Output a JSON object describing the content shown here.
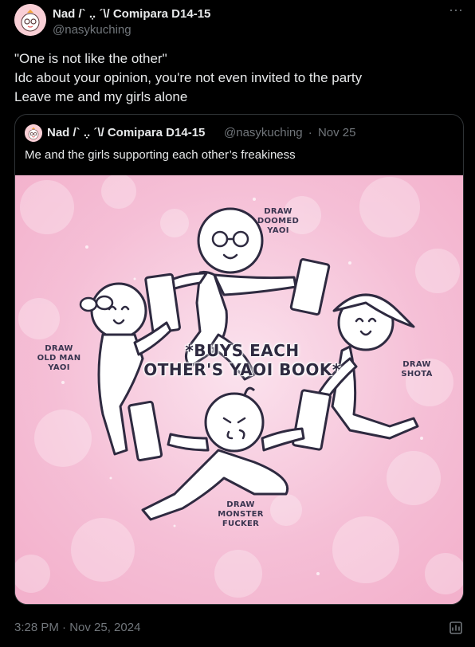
{
  "author": {
    "display_name": "Nad /` .̣. ´\\/ Comipara D14-15",
    "handle": "@nasykuching"
  },
  "tweet": {
    "lines": [
      "\"One is not like the other\"",
      "Idc about your opinion, you're not even invited to the party",
      "Leave me and my girls alone"
    ]
  },
  "quoted": {
    "display_name": "Nad /` .̣. ´\\/ Comipara D14-15",
    "handle": "@nasykuching",
    "separator": "·",
    "date": "Nov 25",
    "text": "Me and the girls supporting each other’s freakiness",
    "image": {
      "caption_line1": "*BUYS EACH",
      "caption_line2": "OTHER'S YAOI BOOK*",
      "labels": {
        "top": [
          "DRAW",
          "DOOMED",
          "YAOI"
        ],
        "left": [
          "DRAW",
          "OLD MAN",
          "YAOI"
        ],
        "right": [
          "DRAW",
          "SHOTA"
        ],
        "bottom": [
          "DRAW",
          "MONSTER",
          "FUCKER"
        ]
      }
    }
  },
  "footer": {
    "timestamp": "3:28 PM · Nov 25, 2024"
  },
  "icons": {
    "more": "more-dots-icon",
    "views": "views-icon"
  },
  "colors": {
    "background": "#000000",
    "text": "#e7e9ea",
    "secondary": "#71767b",
    "image_bg": "#f6c6d8"
  }
}
